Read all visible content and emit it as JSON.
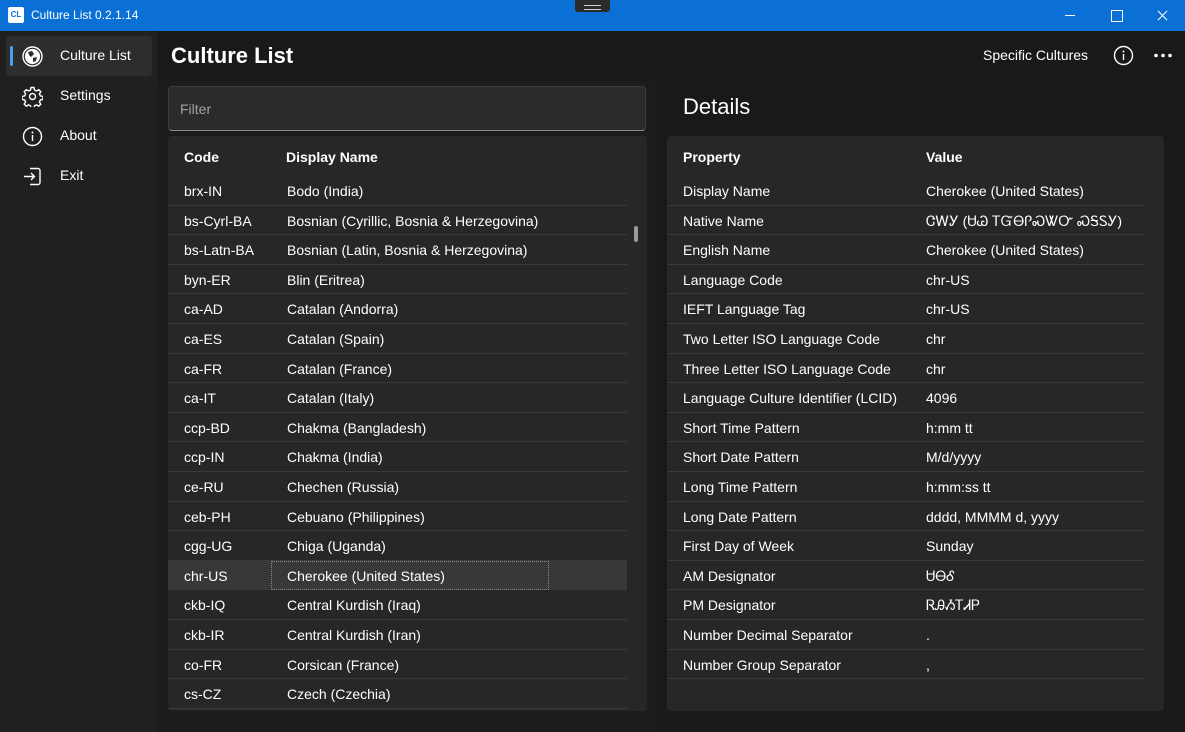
{
  "window": {
    "icon_text": "CL",
    "title": "Culture List  0.2.1.14"
  },
  "sidebar": {
    "items": [
      {
        "label": "Culture List",
        "icon": "globe-icon",
        "active": true
      },
      {
        "label": "Settings",
        "icon": "gear-icon",
        "active": false
      },
      {
        "label": "About",
        "icon": "info-icon",
        "active": false
      },
      {
        "label": "Exit",
        "icon": "exit-icon",
        "active": false
      }
    ]
  },
  "header": {
    "title": "Culture List",
    "specific_cultures_label": "Specific Cultures"
  },
  "filter": {
    "placeholder": "Filter",
    "value": ""
  },
  "culture_grid": {
    "columns": [
      "Code",
      "Display Name"
    ],
    "rows": [
      [
        "brx-IN",
        "Bodo (India)"
      ],
      [
        "bs-Cyrl-BA",
        "Bosnian (Cyrillic, Bosnia & Herzegovina)"
      ],
      [
        "bs-Latn-BA",
        "Bosnian (Latin, Bosnia & Herzegovina)"
      ],
      [
        "byn-ER",
        "Blin (Eritrea)"
      ],
      [
        "ca-AD",
        "Catalan (Andorra)"
      ],
      [
        "ca-ES",
        "Catalan (Spain)"
      ],
      [
        "ca-FR",
        "Catalan (France)"
      ],
      [
        "ca-IT",
        "Catalan (Italy)"
      ],
      [
        "ccp-BD",
        "Chakma (Bangladesh)"
      ],
      [
        "ccp-IN",
        "Chakma (India)"
      ],
      [
        "ce-RU",
        "Chechen (Russia)"
      ],
      [
        "ceb-PH",
        "Cebuano (Philippines)"
      ],
      [
        "cgg-UG",
        "Chiga (Uganda)"
      ],
      [
        "chr-US",
        "Cherokee (United States)"
      ],
      [
        "ckb-IQ",
        "Central Kurdish (Iraq)"
      ],
      [
        "ckb-IR",
        "Central Kurdish (Iran)"
      ],
      [
        "co-FR",
        "Corsican (France)"
      ],
      [
        "cs-CZ",
        "Czech (Czechia)"
      ]
    ],
    "selected_code": "chr-US"
  },
  "details": {
    "title": "Details",
    "columns": [
      "Property",
      "Value"
    ],
    "rows": [
      [
        "Display Name",
        "Cherokee (United States)"
      ],
      [
        "Native Name",
        "ᏣᎳᎩ (ᏌᏊ ᎢᏳᎾᎵᏍᏔᏅ ᏍᎦᏚᎩ)"
      ],
      [
        "English Name",
        "Cherokee (United States)"
      ],
      [
        "Language Code",
        "chr-US"
      ],
      [
        "IEFT Language Tag",
        "chr-US"
      ],
      [
        "Two Letter ISO Language Code",
        "chr"
      ],
      [
        "Three Letter ISO Language Code",
        "chr"
      ],
      [
        "Language Culture Identifier (LCID)",
        "4096"
      ],
      [
        "Short Time Pattern",
        "h:mm tt"
      ],
      [
        "Short Date Pattern",
        "M/d/yyyy"
      ],
      [
        "Long Time Pattern",
        "h:mm:ss tt"
      ],
      [
        "Long Date Pattern",
        "dddd, MMMM d, yyyy"
      ],
      [
        "First Day of Week",
        "Sunday"
      ],
      [
        "AM Designator",
        "ᏌᎾᎴ"
      ],
      [
        "PM Designator",
        "ᏒᎯᏱᎢᏗᏢ"
      ],
      [
        "Number Decimal Separator",
        "."
      ],
      [
        "Number Group Separator",
        ","
      ]
    ]
  },
  "colors": {
    "titlebar": "#0a70d6",
    "accent": "#4aa0e6",
    "background": "#191919"
  }
}
